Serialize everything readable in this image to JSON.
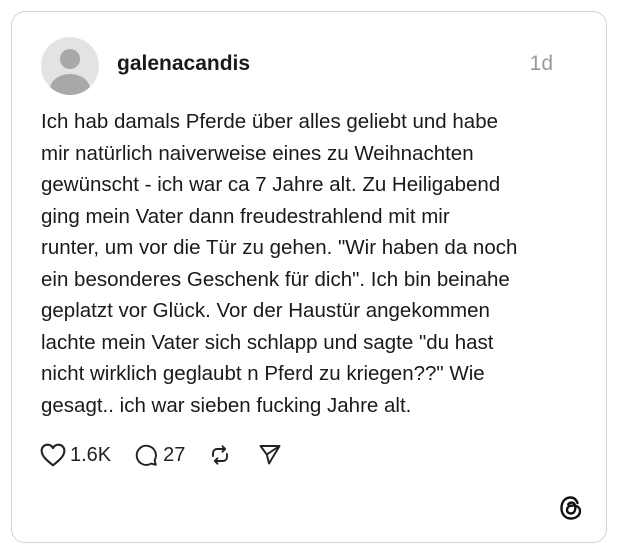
{
  "post": {
    "username": "galenacandis",
    "time": "1d",
    "text": "Ich hab damals Pferde über alles geliebt und habe\nmir natürlich naiverweise eines zu Weihnachten\ngewünscht - ich war ca 7 Jahre alt. Zu Heiligabend\nging mein Vater dann freudestrahlend mit mir\nrunter, um vor die Tür zu gehen. \"Wir haben da noch\nein besonderes Geschenk für dich\". Ich bin beinahe\ngeplatzt vor Glück. Vor der Haustür angekommen\nlachte mein Vater sich schlapp und sagte \"du hast\nnicht wirklich geglaubt n Pferd zu kriegen??\" Wie\ngesagt.. ich war sieben fucking Jahre alt."
  },
  "actions": {
    "likes": "1.6K",
    "replies": "27"
  },
  "icons": {
    "avatar": "default-avatar-icon",
    "like": "heart-icon",
    "reply": "comment-bubble-icon",
    "repost": "repost-icon",
    "share": "send-icon",
    "logo": "threads-logo-icon"
  },
  "colors": {
    "border": "#d4d4d4",
    "avatar_bg": "#e3e3e3",
    "avatar_fg": "#a8a8a8",
    "muted": "#999999"
  }
}
